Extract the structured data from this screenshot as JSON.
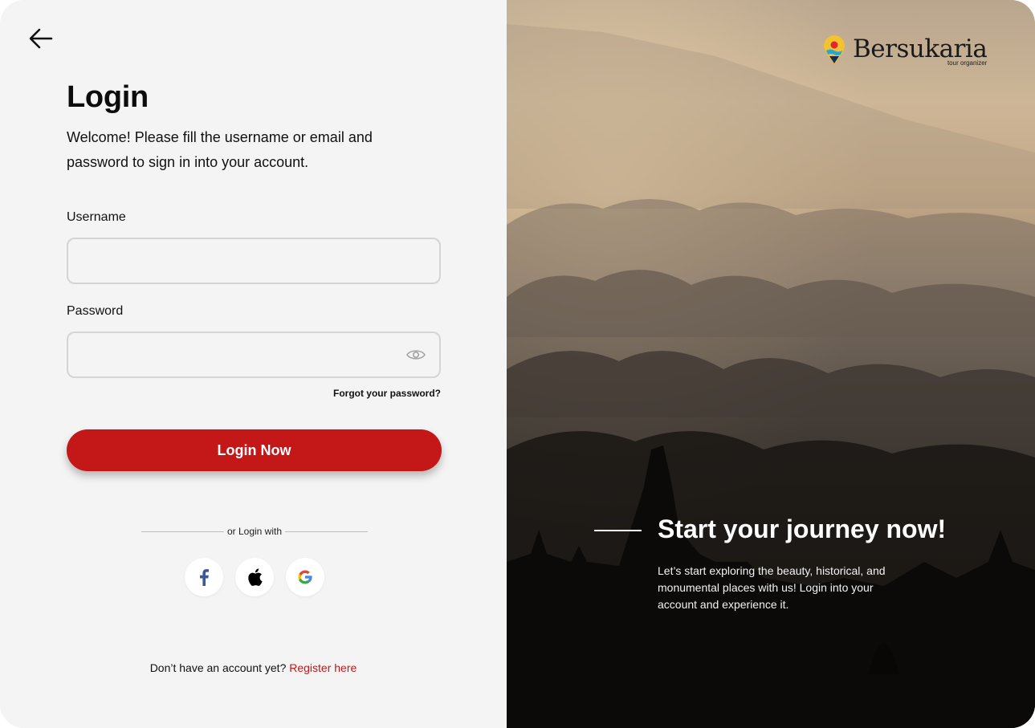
{
  "login": {
    "title": "Login",
    "subtitle": "Welcome! Please fill the username or email and password to sign in into your account.",
    "username_label": "Username",
    "username_value": "",
    "password_label": "Password",
    "password_value": "",
    "forgot": "Forgot your password?",
    "submit": "Login Now",
    "divider": "or Login with",
    "social": [
      {
        "name": "facebook-icon",
        "color": "#1877f2"
      },
      {
        "name": "apple-icon",
        "color": "#000000"
      },
      {
        "name": "google-icon",
        "color": "#4285f4"
      }
    ],
    "no_account": "Don’t have an account yet?",
    "register": "Register here"
  },
  "hero": {
    "brand": "Bersukaria",
    "brand_tagline": "tour organizer",
    "headline": "Start your journey now!",
    "description": "Let’s start exploring the beauty, historical, and monumental places with us! Login into your account and experience it."
  },
  "colors": {
    "accent": "#c41718",
    "background": "#f4f4f4",
    "field_border": "#d4d4d4"
  }
}
